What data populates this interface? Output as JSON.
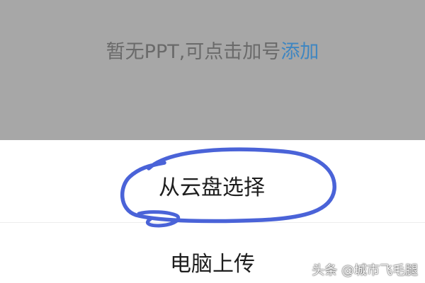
{
  "empty_state": {
    "message": "暂无PPT,可点击加号",
    "add_link": "添加"
  },
  "upload_options": [
    {
      "label": "从云盘选择"
    },
    {
      "label": "电脑上传"
    }
  ],
  "watermark": {
    "text": "头条 @城市飞毛腿"
  },
  "colors": {
    "overlay": "#a7a7a7",
    "link": "#3f86c1",
    "annotation": "#4a63d8"
  }
}
